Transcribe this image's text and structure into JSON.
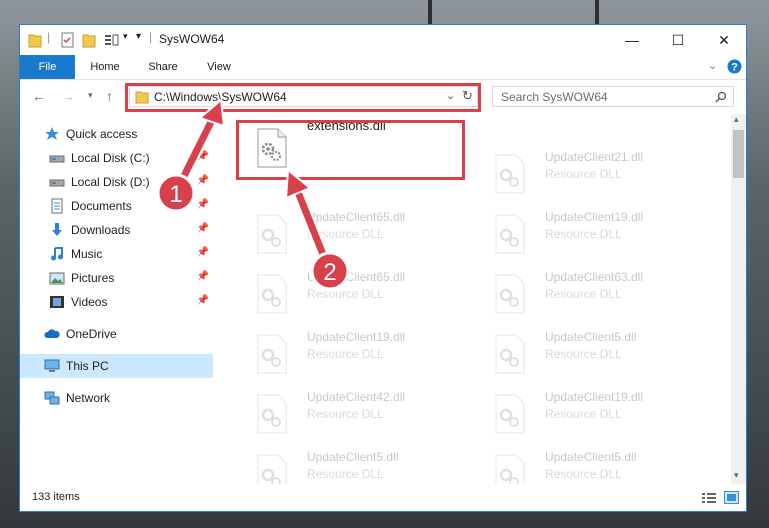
{
  "window": {
    "title": "SysWOW64",
    "controls": {
      "minimize": "—",
      "maximize": "☐",
      "close": "✕"
    }
  },
  "ribbon": {
    "tabs": [
      "File",
      "Home",
      "Share",
      "View"
    ]
  },
  "address": {
    "path": "C:\\Windows\\SysWOW64",
    "search_placeholder": "Search SysWOW64"
  },
  "nav": {
    "items": [
      {
        "label": "Quick access",
        "icon": "star-icon",
        "pinned": false
      },
      {
        "label": "Local Disk (C:)",
        "icon": "drive-icon",
        "pinned": true
      },
      {
        "label": "Local Disk (D:)",
        "icon": "drive-icon",
        "pinned": true
      },
      {
        "label": "Documents",
        "icon": "documents-icon",
        "pinned": true
      },
      {
        "label": "Downloads",
        "icon": "download-icon",
        "pinned": true
      },
      {
        "label": "Music",
        "icon": "music-icon",
        "pinned": true
      },
      {
        "label": "Pictures",
        "icon": "pictures-icon",
        "pinned": true
      },
      {
        "label": "Videos",
        "icon": "videos-icon",
        "pinned": true
      },
      {
        "label": "OneDrive",
        "icon": "cloud-icon",
        "pinned": false
      },
      {
        "label": "This PC",
        "icon": "computer-icon",
        "pinned": false
      },
      {
        "label": "Network",
        "icon": "network-icon",
        "pinned": false
      }
    ]
  },
  "files": {
    "col1": [
      {
        "name": "extensions.dll",
        "type": ""
      },
      {
        "name": "",
        "type": ""
      },
      {
        "name": "UpdateClient65.dll",
        "type": "Resource DLL"
      },
      {
        "name": "UpdateClient19.dll",
        "type": "Resource DLL"
      },
      {
        "name": "UpdateClient42.dll",
        "type": "Resource DLL"
      },
      {
        "name": "UpdateClient5.dll",
        "type": "Resource DLL"
      }
    ],
    "col2": [
      {
        "name": "UpdateClient21.dll",
        "type": "Resource DLL"
      },
      {
        "name": "UpdateClient19.dll",
        "type": "Resource DLL"
      },
      {
        "name": "UpdateClient63.dll",
        "type": "Resource DLL"
      },
      {
        "name": "UpdateClient5.dll",
        "type": "Resource DLL"
      },
      {
        "name": "UpdateClient19.dll",
        "type": "Resource DLL"
      },
      {
        "name": "UpdateClient5.dll",
        "type": "Resource DLL"
      }
    ],
    "col1_row1b": {
      "name": "UpdateClient65.dll",
      "type": "Resource DLL"
    }
  },
  "status": {
    "count": "133 items"
  },
  "annotations": {
    "badge1": "1",
    "badge2": "2"
  },
  "colors": {
    "accent": "#1979ca",
    "highlight": "#d8404b",
    "selected": "#cce8ff"
  }
}
